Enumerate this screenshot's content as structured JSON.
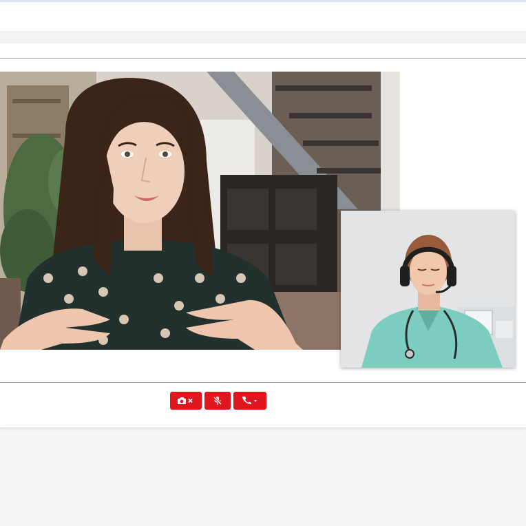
{
  "video_call": {
    "remote_video": {
      "description_icon": "remote-participant-feed"
    },
    "local_video": {
      "description_icon": "local-camera-preview"
    },
    "controls": {
      "camera_toggle": {
        "icon": "camera-off-icon"
      },
      "mic_toggle": {
        "icon": "microphone-mute-icon"
      },
      "call_menu": {
        "icon": "phone-icon",
        "caret": "caret-down-icon"
      }
    },
    "colors": {
      "button_bg": "#e0161e",
      "page_bg": "#f5f5f5"
    }
  }
}
